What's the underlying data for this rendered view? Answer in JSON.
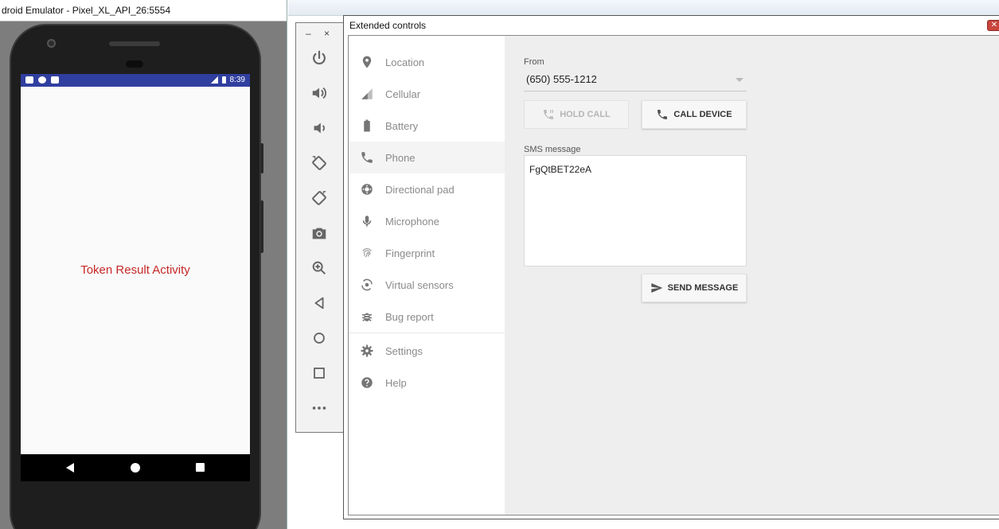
{
  "emulator": {
    "window_title": "droid Emulator - Pixel_XL_API_26:5554",
    "status_time": "8:39",
    "activity_text": "Token Result Activity"
  },
  "side_toolbar": {
    "minimize": "–",
    "close": "×",
    "buttons": [
      "power-icon",
      "volume-up-icon",
      "volume-down-icon",
      "rotate-left-icon",
      "rotate-right-icon",
      "camera-icon",
      "zoom-icon",
      "back-icon",
      "home-icon",
      "overview-icon",
      "more-icon"
    ]
  },
  "extended": {
    "title": "Extended controls",
    "close": "✕",
    "nav": [
      {
        "label": "Location",
        "icon": "location-pin-icon"
      },
      {
        "label": "Cellular",
        "icon": "signal-icon"
      },
      {
        "label": "Battery",
        "icon": "battery-icon"
      },
      {
        "label": "Phone",
        "icon": "phone-icon"
      },
      {
        "label": "Directional pad",
        "icon": "dpad-icon"
      },
      {
        "label": "Microphone",
        "icon": "microphone-icon"
      },
      {
        "label": "Fingerprint",
        "icon": "fingerprint-icon"
      },
      {
        "label": "Virtual sensors",
        "icon": "sensors-icon"
      },
      {
        "label": "Bug report",
        "icon": "bug-icon"
      },
      {
        "label": "Settings",
        "icon": "gear-icon"
      },
      {
        "label": "Help",
        "icon": "help-icon"
      }
    ],
    "active_nav": "Phone",
    "phone": {
      "from_label": "From",
      "from_value": "(650) 555-1212",
      "hold_call": "HOLD CALL",
      "call_device": "CALL DEVICE",
      "sms_label": "SMS message",
      "sms_value": "FgQtBET22eA",
      "send_message": "SEND MESSAGE"
    }
  },
  "colors": {
    "status_bar": "#303f9f",
    "activity_text": "#c62828",
    "nav_text": "#8a8a8a"
  }
}
